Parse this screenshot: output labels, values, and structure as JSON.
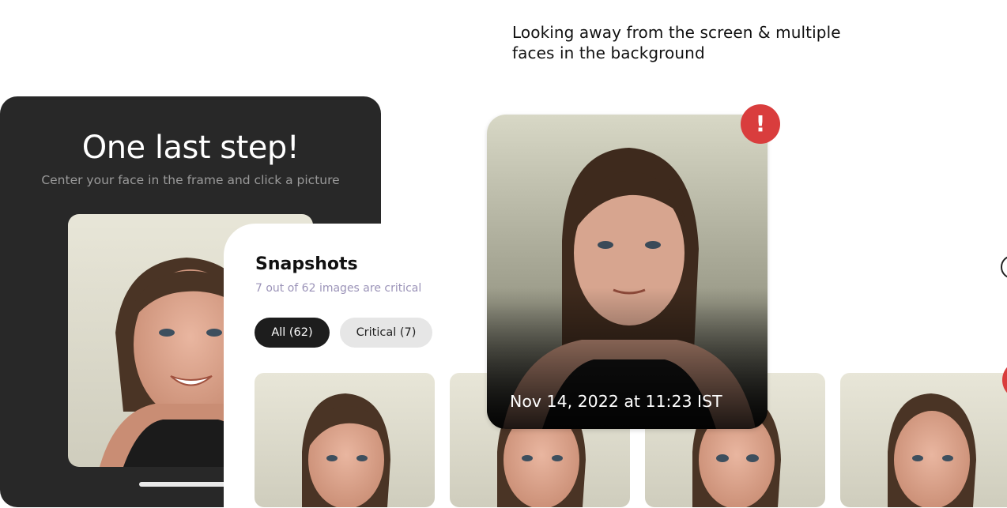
{
  "caption": "Looking away from the screen & multiple faces in the background",
  "onboarding": {
    "title": "One last step!",
    "subtitle": "Center your face in the frame and click a picture"
  },
  "snapshots": {
    "title": "Snapshots",
    "subtitle": "7 out of 62 images are critical",
    "filters": {
      "all_label": "All (62)",
      "critical_label": "Critical (7)"
    }
  },
  "preview": {
    "timestamp": "Nov 14, 2022 at 11:23 IST",
    "alert_symbol": "!"
  },
  "colors": {
    "alert": "#d93d3d",
    "dark_card": "#282828",
    "subtitle_purple": "#9b93b8"
  }
}
